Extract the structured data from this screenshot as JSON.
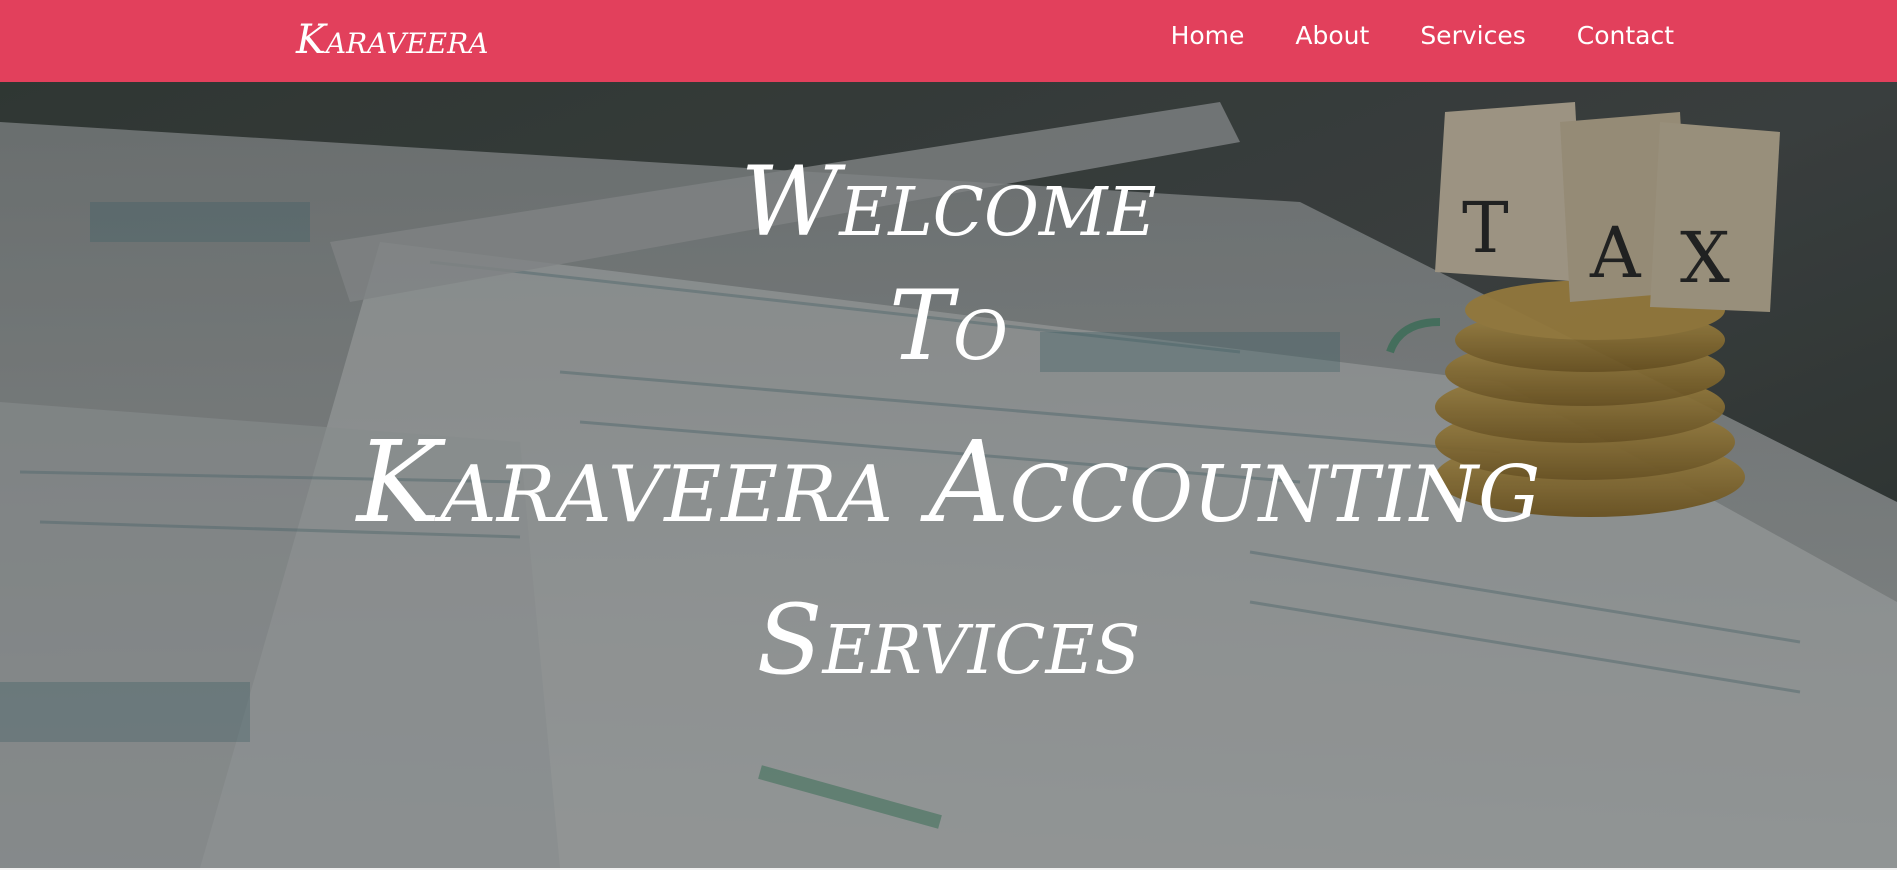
{
  "navbar": {
    "brand": "Karaveera",
    "links": [
      "Home",
      "About",
      "Services",
      "Contact"
    ],
    "background_color": "#e2405c"
  },
  "hero": {
    "title_lines": [
      "Welcome",
      "To",
      "Karaveera Accounting",
      "Services"
    ],
    "text_color": "#ffffff"
  }
}
